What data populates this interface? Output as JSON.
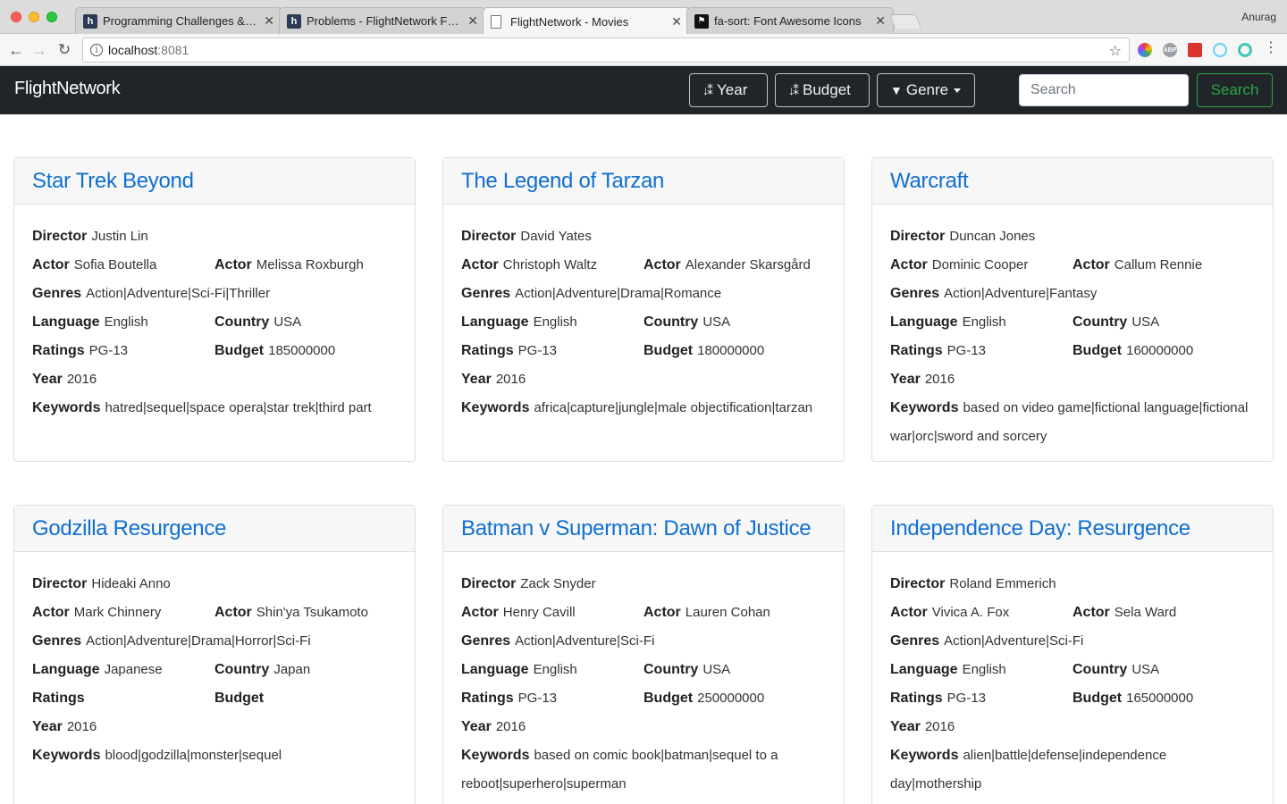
{
  "browser": {
    "tabs": [
      {
        "title": "Programming Challenges & Co",
        "icon": "hackerearth-icon"
      },
      {
        "title": "Problems - FlightNetwork Fron",
        "icon": "hackerearth-icon"
      },
      {
        "title": "FlightNetwork - Movies",
        "icon": "document-icon",
        "active": true
      },
      {
        "title": "fa-sort: Font Awesome Icons",
        "icon": "flag-icon"
      }
    ],
    "profile_name": "Anurag",
    "url_host": "localhost",
    "url_port": ":8081"
  },
  "navbar": {
    "brand": "FlightNetwork",
    "year_label": "Year",
    "budget_label": "Budget",
    "genre_label": "Genre",
    "search_placeholder": "Search",
    "search_button": "Search"
  },
  "labels": {
    "director": "Director",
    "actor": "Actor",
    "genres": "Genres",
    "language": "Language",
    "country": "Country",
    "ratings": "Ratings",
    "budget": "Budget",
    "year": "Year",
    "keywords": "Keywords"
  },
  "movies": [
    {
      "title": "Star Trek Beyond",
      "director": "Justin Lin",
      "actor1": "Sofia Boutella",
      "actor2": "Melissa Roxburgh",
      "genres": "Action|Adventure|Sci-Fi|Thriller",
      "language": "English",
      "country": "USA",
      "ratings": "PG-13",
      "budget": "185000000",
      "year": "2016",
      "keywords": "hatred|sequel|space opera|star trek|third part"
    },
    {
      "title": "The Legend of Tarzan",
      "director": "David Yates",
      "actor1": "Christoph Waltz",
      "actor2": "Alexander Skarsgård",
      "genres": "Action|Adventure|Drama|Romance",
      "language": "English",
      "country": "USA",
      "ratings": "PG-13",
      "budget": "180000000",
      "year": "2016",
      "keywords": "africa|capture|jungle|male objectification|tarzan"
    },
    {
      "title": "Warcraft",
      "director": "Duncan Jones",
      "actor1": "Dominic Cooper",
      "actor2": "Callum Rennie",
      "genres": "Action|Adventure|Fantasy",
      "language": "English",
      "country": "USA",
      "ratings": "PG-13",
      "budget": "160000000",
      "year": "2016",
      "keywords": "based on video game|fictional language|fictional war|orc|sword and sorcery"
    },
    {
      "title": "Godzilla Resurgence",
      "director": "Hideaki Anno",
      "actor1": "Mark Chinnery",
      "actor2": "Shin'ya Tsukamoto",
      "genres": "Action|Adventure|Drama|Horror|Sci-Fi",
      "language": "Japanese",
      "country": "Japan",
      "ratings": "",
      "budget": "",
      "year": "2016",
      "keywords": "blood|godzilla|monster|sequel"
    },
    {
      "title": "Batman v Superman: Dawn of Justice",
      "director": "Zack Snyder",
      "actor1": "Henry Cavill",
      "actor2": "Lauren Cohan",
      "genres": "Action|Adventure|Sci-Fi",
      "language": "English",
      "country": "USA",
      "ratings": "PG-13",
      "budget": "250000000",
      "year": "2016",
      "keywords": "based on comic book|batman|sequel to a reboot|superhero|superman"
    },
    {
      "title": "Independence Day: Resurgence",
      "director": "Roland Emmerich",
      "actor1": "Vivica A. Fox",
      "actor2": "Sela Ward",
      "genres": "Action|Adventure|Sci-Fi",
      "language": "English",
      "country": "USA",
      "ratings": "PG-13",
      "budget": "165000000",
      "year": "2016",
      "keywords": "alien|battle|defense|independence day|mothership"
    }
  ]
}
